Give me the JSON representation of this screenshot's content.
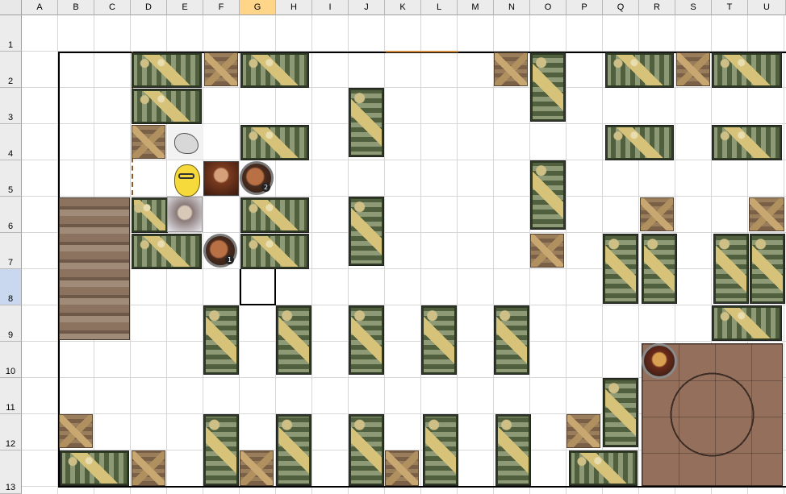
{
  "sheet": {
    "columns": [
      "A",
      "B",
      "C",
      "D",
      "E",
      "F",
      "G",
      "H",
      "I",
      "J",
      "K",
      "L",
      "M",
      "N",
      "O",
      "P",
      "Q",
      "R",
      "S",
      "T",
      "U"
    ],
    "selected_column": "G",
    "rows": [
      "1",
      "2",
      "3",
      "4",
      "5",
      "6",
      "7",
      "8",
      "9",
      "10",
      "11",
      "12",
      "13"
    ],
    "selected_row": "8"
  },
  "tokens": {
    "monster_1_number": "1",
    "monster_2_number": "2"
  }
}
